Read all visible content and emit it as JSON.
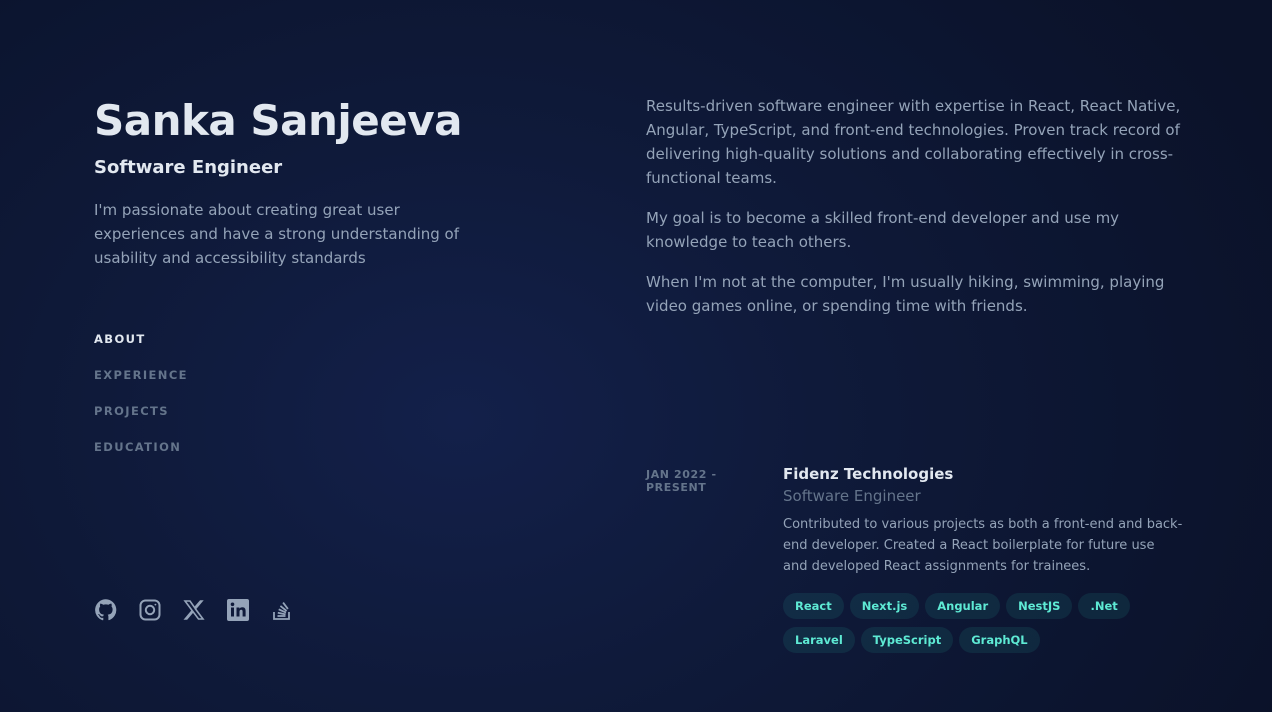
{
  "header": {
    "name": "Sanka Sanjeeva",
    "role": "Software Engineer",
    "tagline": "I'm passionate about creating great user experiences and have a strong understanding of usability and accessibility standards"
  },
  "nav": {
    "items": [
      {
        "label": "ABOUT",
        "active": true
      },
      {
        "label": "EXPERIENCE",
        "active": false
      },
      {
        "label": "PROJECTS",
        "active": false
      },
      {
        "label": "EDUCATION",
        "active": false
      }
    ]
  },
  "socials": [
    "github-icon",
    "instagram-icon",
    "x-icon",
    "linkedin-icon",
    "stackoverflow-icon"
  ],
  "about": {
    "paragraphs": [
      "Results-driven software engineer with expertise in React, React Native, Angular, TypeScript, and front-end technologies. Proven track record of delivering high-quality solutions and collaborating effectively in cross-functional teams.",
      "My goal is to become a skilled front-end developer and use my knowledge to teach others.",
      "When I'm not at the computer, I'm usually hiking, swimming, playing video games online, or spending time with friends."
    ]
  },
  "experience": [
    {
      "date": "JAN 2022 - PRESENT",
      "company": "Fidenz Technologies",
      "title": "Software Engineer",
      "description": "Contributed to various projects as both a front-end and back-end developer. Created a React boilerplate for future use and developed React assignments for trainees.",
      "tags": [
        "React",
        "Next.js",
        "Angular",
        "NestJS",
        ".Net",
        "Laravel",
        "TypeScript",
        "GraphQL"
      ]
    }
  ],
  "colors": {
    "background": "#0f172a",
    "heading": "#e2e8f0",
    "text": "#94a3b8",
    "muted": "#64748b",
    "accent": "#5eead4"
  }
}
